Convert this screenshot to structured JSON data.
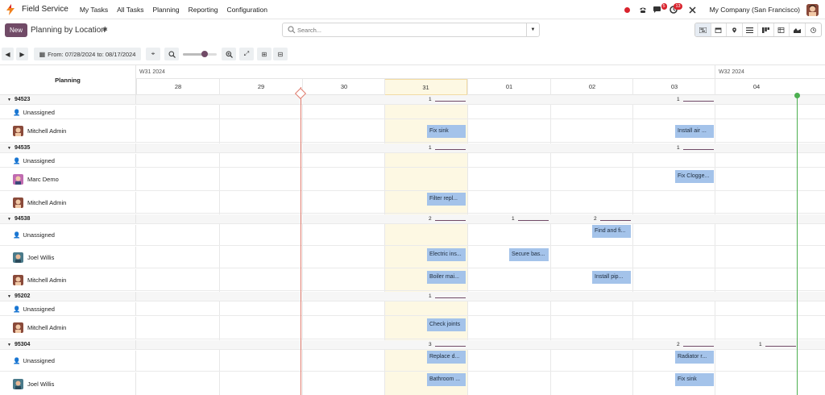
{
  "nav": {
    "app_name": "Field Service",
    "menu": [
      "My Tasks",
      "All Tasks",
      "Planning",
      "Reporting",
      "Configuration"
    ],
    "messages_badge": "5",
    "activity_badge": "13",
    "company": "My Company (San Francisco)"
  },
  "control": {
    "new_label": "New",
    "title": "Planning by Location",
    "search_placeholder": "Search..."
  },
  "toolbar": {
    "range_label": "From: 07/28/2024 to: 08/17/2024"
  },
  "gantt": {
    "planning_header": "Planning",
    "weeks": [
      "W31 2024",
      "W32 2024"
    ],
    "days": [
      "28",
      "29",
      "30",
      "31",
      "01",
      "02",
      "03",
      "04"
    ],
    "today_day": "31"
  },
  "groups": [
    {
      "name": "94523",
      "counts": [
        "1",
        "",
        "",
        "",
        "1"
      ]
    },
    {
      "name": "94535",
      "counts": [
        "1",
        "",
        "",
        "",
        "1"
      ]
    },
    {
      "name": "94538",
      "counts": [
        "2",
        "1",
        "2"
      ]
    },
    {
      "name": "95202",
      "counts": [
        "1"
      ]
    },
    {
      "name": "95304",
      "counts": [
        "3",
        "2",
        "1"
      ]
    }
  ],
  "rows": [
    {
      "label": "Unassigned"
    },
    {
      "label": "Mitchell Admin"
    },
    {
      "label": "Unassigned"
    },
    {
      "label": "Marc Demo"
    },
    {
      "label": "Mitchell Admin"
    },
    {
      "label": "Unassigned"
    },
    {
      "label": "Joel Willis"
    },
    {
      "label": "Mitchell Admin"
    },
    {
      "label": "Unassigned"
    },
    {
      "label": "Mitchell Admin"
    },
    {
      "label": "Unassigned"
    },
    {
      "label": "Joel Willis"
    }
  ],
  "tasks": [
    "Fix sink",
    "Install air ...",
    "Fix Clogge...",
    "Filter repl...",
    "Find and fi...",
    "Electric ins...",
    "Secure bas...",
    "Boiler mai...",
    "Install pip...",
    "Check joints",
    "Replace d...",
    "Radiator r...",
    "Bathroom ...",
    "Fix sink"
  ]
}
